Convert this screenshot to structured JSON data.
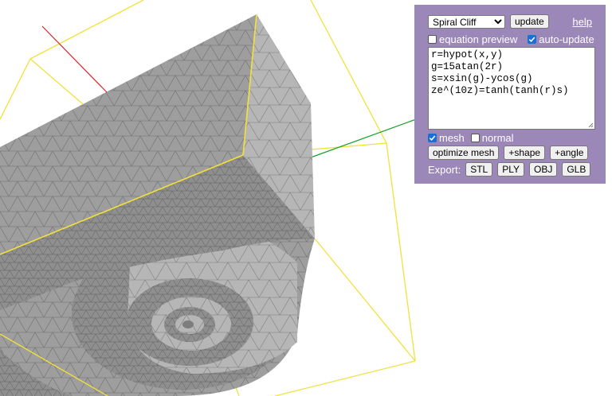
{
  "shape_select": {
    "selected": "Spiral Cliff"
  },
  "buttons": {
    "update": "update",
    "optimize_mesh": "optimize mesh",
    "add_shape": "+shape",
    "add_angle": "+angle"
  },
  "help_link": "help",
  "options": {
    "equation_preview": {
      "label": "equation preview",
      "checked": false
    },
    "auto_update": {
      "label": "auto-update",
      "checked": true
    },
    "mesh": {
      "label": "mesh",
      "checked": true
    },
    "normal": {
      "label": "normal",
      "checked": false
    }
  },
  "equation_lines": [
    "r=hypot(x,y)",
    "g=15atan(2r)",
    "s=xsin(g)-ycos(g)",
    "ze^(10z)=tanh(tanh(r)s)"
  ],
  "export": {
    "label": "Export:",
    "formats": [
      "STL",
      "PLY",
      "OBJ",
      "GLB"
    ]
  },
  "colors": {
    "panel_background": "#9b87b8",
    "bounding_box": "#f2e13a",
    "axis_x": "#d8212b",
    "axis_y": "#1aa12b",
    "mesh_surface": "#9b9b9b",
    "mesh_edges": "#6a6a6a"
  },
  "icons": {
    "checkbox_checked": "check-icon",
    "textarea_resize": "resize-grip-icon"
  }
}
